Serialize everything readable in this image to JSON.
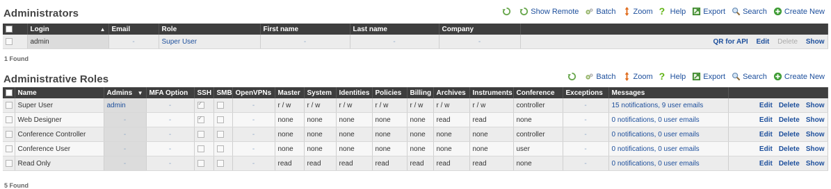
{
  "admins": {
    "title": "Administrators",
    "toolbar": {
      "refresh": "",
      "show_remote": "Show Remote",
      "batch": "Batch",
      "zoom": "Zoom",
      "help": "Help",
      "export": "Export",
      "search": "Search",
      "create_new": "Create New"
    },
    "columns": [
      "Login",
      "Email",
      "Role",
      "First name",
      "Last name",
      "Company"
    ],
    "rows": [
      {
        "login": "admin",
        "email": "-",
        "role": "Super User",
        "first_name": "-",
        "last_name": "-",
        "company": "-",
        "actions": {
          "qr": "QR for API",
          "edit": "Edit",
          "delete": "Delete",
          "show": "Show"
        }
      }
    ],
    "found": "1 Found"
  },
  "roles": {
    "title": "Administrative Roles",
    "toolbar": {
      "batch": "Batch",
      "zoom": "Zoom",
      "help": "Help",
      "export": "Export",
      "search": "Search",
      "create_new": "Create New"
    },
    "columns": [
      "Name",
      "Admins",
      "MFA Option",
      "SSH",
      "SMB",
      "OpenVPNs",
      "Master",
      "System",
      "Identities",
      "Policies",
      "Billing",
      "Archives",
      "Instruments",
      "Conference",
      "Exceptions",
      "Messages"
    ],
    "rows": [
      {
        "name": "Super User",
        "admins": "admin",
        "mfa": "-",
        "ssh": true,
        "smb": false,
        "openvpns": "-",
        "master": "r / w",
        "system": "r / w",
        "identities": "r / w",
        "policies": "r / w",
        "billing": "r / w",
        "archives": "r / w",
        "instruments": "r / w",
        "conference": "controller",
        "exceptions": "-",
        "messages": "15 notifications, 9 user emails"
      },
      {
        "name": "Web Designer",
        "admins": "-",
        "mfa": "-",
        "ssh": true,
        "smb": false,
        "openvpns": "-",
        "master": "none",
        "system": "none",
        "identities": "none",
        "policies": "none",
        "billing": "none",
        "archives": "read",
        "instruments": "read",
        "conference": "none",
        "exceptions": "-",
        "messages": "0 notifications, 0 user emails"
      },
      {
        "name": "Conference Controller",
        "admins": "-",
        "mfa": "-",
        "ssh": false,
        "smb": false,
        "openvpns": "-",
        "master": "none",
        "system": "none",
        "identities": "none",
        "policies": "none",
        "billing": "none",
        "archives": "none",
        "instruments": "none",
        "conference": "controller",
        "exceptions": "-",
        "messages": "0 notifications, 0 user emails"
      },
      {
        "name": "Conference User",
        "admins": "-",
        "mfa": "-",
        "ssh": false,
        "smb": false,
        "openvpns": "-",
        "master": "none",
        "system": "none",
        "identities": "none",
        "policies": "none",
        "billing": "none",
        "archives": "none",
        "instruments": "none",
        "conference": "user",
        "exceptions": "-",
        "messages": "0 notifications, 0 user emails"
      },
      {
        "name": "Read Only",
        "admins": "-",
        "mfa": "-",
        "ssh": false,
        "smb": false,
        "openvpns": "-",
        "master": "read",
        "system": "read",
        "identities": "read",
        "policies": "read",
        "billing": "read",
        "archives": "read",
        "instruments": "read",
        "conference": "none",
        "exceptions": "-",
        "messages": "0 notifications, 0 user emails"
      }
    ],
    "actions": {
      "edit": "Edit",
      "delete": "Delete",
      "show": "Show"
    },
    "found": "5 Found"
  },
  "colors": {
    "header_bg": "#3e3e3e",
    "link": "#1d4f9c",
    "refresh_green": "#6aa84f",
    "zoom_orange": "#e06a1a",
    "help_green": "#5fb312",
    "create_green": "#3f9c35"
  },
  "icons": {
    "refresh": "refresh-icon",
    "batch": "batch-gear-icon",
    "zoom": "zoom-arrows-icon",
    "help": "help-question-icon",
    "export": "export-icon",
    "search": "search-magnifier-icon",
    "create_new": "plus-circle-icon"
  }
}
